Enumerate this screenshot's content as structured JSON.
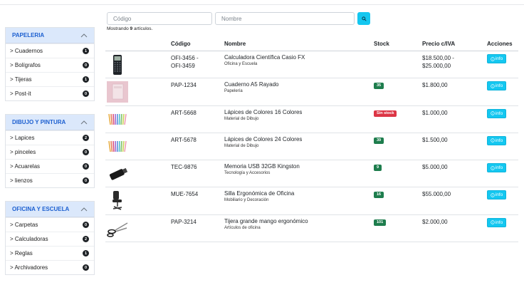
{
  "sidebar": {
    "categories": [
      {
        "title": "PAPELERIA",
        "items": [
          {
            "label": "> Cuadernos",
            "count": "1"
          },
          {
            "label": "> Bolígrafos",
            "count": "0"
          },
          {
            "label": "> Tijeras",
            "count": "1"
          },
          {
            "label": "> Post-it",
            "count": "0"
          }
        ]
      },
      {
        "title": "DIBUJO Y PINTURA",
        "items": [
          {
            "label": "> Lapices",
            "count": "2"
          },
          {
            "label": "> pinceles",
            "count": "0"
          },
          {
            "label": "> Acuarelas",
            "count": "0"
          },
          {
            "label": "> lienzos",
            "count": "0"
          }
        ]
      },
      {
        "title": "OFICINA Y ESCUELA",
        "items": [
          {
            "label": "> Carpetas",
            "count": "0"
          },
          {
            "label": "> Calculadoras",
            "count": "2"
          },
          {
            "label": "> Reglas",
            "count": "1"
          },
          {
            "label": "> Archivadores",
            "count": "0"
          }
        ]
      }
    ]
  },
  "search": {
    "code_placeholder": "Código",
    "name_placeholder": "Nombre",
    "button_icon": "search-icon"
  },
  "summary": {
    "prefix": "Mostrando",
    "count": "9",
    "suffix": "artículos."
  },
  "table": {
    "headers": {
      "code": "Código",
      "name": "Nombre",
      "stock": "Stock",
      "price": "Precio c/IVA",
      "actions": "Acciones"
    },
    "rows": [
      {
        "code": "OFI-3456 -",
        "code2": "OFI-3459",
        "name": "Calculadora Científica Casio FX",
        "category": "Oficina y Escuela",
        "stock": "",
        "price": "$18.500,00 -",
        "price2": "$25.000,00",
        "action": "info",
        "image": "calculator"
      },
      {
        "code": "PAP-1234",
        "code2": "",
        "name": "Cuaderno A5 Rayado",
        "category": "Papelería",
        "stock": "35",
        "price": "$1.800,00",
        "price2": "",
        "action": "info",
        "image": "notebook"
      },
      {
        "code": "ART-5668",
        "code2": "",
        "name": "Lápices de Colores 16 Colores",
        "category": "Material de Dibujo",
        "stock": "Sin stock",
        "price": "$1.000,00",
        "price2": "",
        "action": "info",
        "image": "pencils"
      },
      {
        "code": "ART-5678",
        "code2": "",
        "name": "Lápices de Colores 24 Colores",
        "category": "Material de Dibujo",
        "stock": "39",
        "price": "$1.500,00",
        "price2": "",
        "action": "info",
        "image": "pencils"
      },
      {
        "code": "TEC-9876",
        "code2": "",
        "name": "Memoria USB 32GB Kingston",
        "category": "Tecnología y Accesorios",
        "stock": "9",
        "price": "$5.000,00",
        "price2": "",
        "action": "info",
        "image": "usb"
      },
      {
        "code": "MUE-7654",
        "code2": "",
        "name": "Silla Ergonómica de Oficina",
        "category": "Mobiliario y Decoración",
        "stock": "16",
        "price": "$55.000,00",
        "price2": "",
        "action": "info",
        "image": "chair"
      },
      {
        "code": "PAP-3214",
        "code2": "",
        "name": "Tijera grande mango ergonómico",
        "category": "Artículos de oficina",
        "stock": "101",
        "price": "$2.000,00",
        "price2": "",
        "action": "info",
        "image": "scissors"
      }
    ]
  },
  "colors": {
    "accent": "#14c7f0",
    "category_header_bg": "#dbe8fb",
    "category_title": "#1c5fd0",
    "stock_ok": "#1e7d4d",
    "stock_out": "#dc3545"
  }
}
